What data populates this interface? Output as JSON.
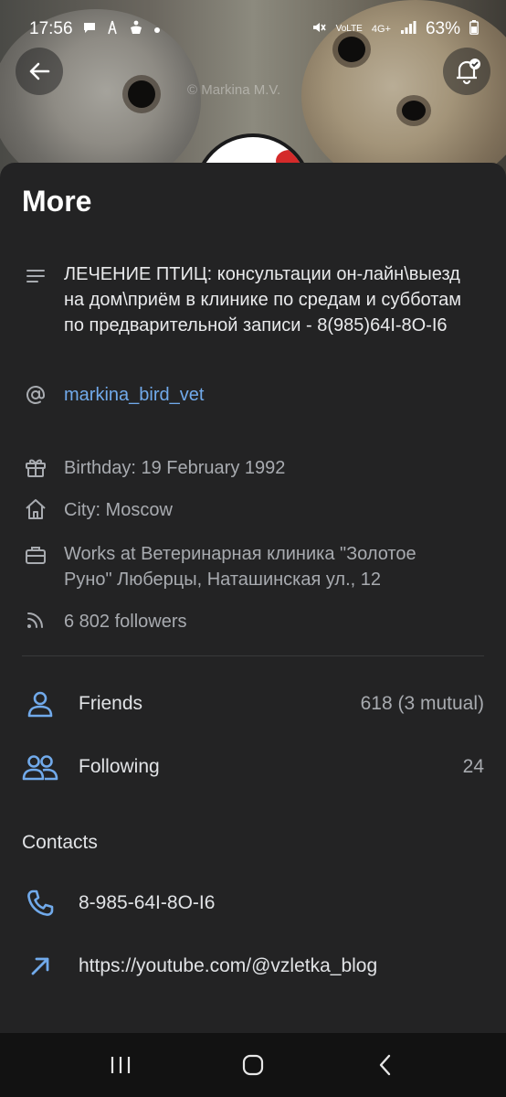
{
  "status_bar": {
    "time": "17:56",
    "battery": "63%",
    "network": "4G+",
    "volte": "VoLTE",
    "icons": [
      "chat-icon",
      "signal-tower-icon",
      "accessibility-icon",
      "dot-icon",
      "mute-icon",
      "signal-icon",
      "battery-icon"
    ]
  },
  "cover": {
    "watermark": "© Markina M.V."
  },
  "sheet": {
    "title": "More",
    "description": "ЛЕЧЕНИЕ ПТИЦ: консультации он-лайн\\выезд на дом\\приём в клинике по средам и субботам по предварительной записи - 8(985)64I-8O-I6",
    "username": "markina_bird_vet",
    "birthday": "Birthday: 19 February 1992",
    "city": "City: Moscow",
    "works": "Works at Ветеринарная клиника \"Золотое Руно\" Люберцы, Наташинская ул., 12",
    "followers": "6 802 followers",
    "friends": {
      "label": "Friends",
      "value": "618 (3 mutual)"
    },
    "following": {
      "label": "Following",
      "value": "24"
    },
    "contacts_title": "Contacts",
    "phone": "8-985-64I-8O-I6",
    "website": "https://youtube.com/@vzletka_blog"
  },
  "colors": {
    "accent": "#71aaeb",
    "sheet_bg": "#232324",
    "text": "#e1e3e6",
    "muted": "#a8abb0"
  }
}
